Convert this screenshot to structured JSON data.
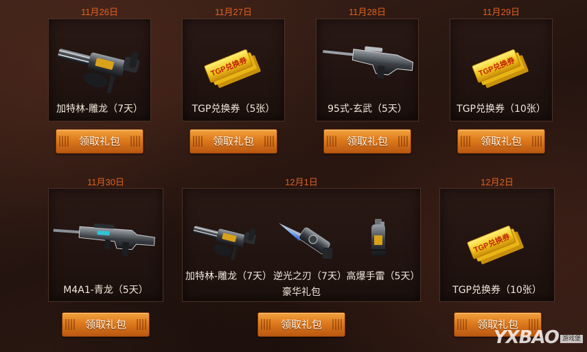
{
  "claim_label": "领取礼包",
  "days": [
    {
      "date": "11月26日",
      "items": [
        "加特林-雕龙（7天）"
      ],
      "art": [
        "gatling-gun-icon"
      ]
    },
    {
      "date": "11月27日",
      "items": [
        "TGP兑换券（5张）"
      ],
      "art": [
        "tgp-voucher-icon"
      ]
    },
    {
      "date": "11月28日",
      "items": [
        "95式-玄武（5天）"
      ],
      "art": [
        "rifle-icon"
      ]
    },
    {
      "date": "11月29日",
      "items": [
        "TGP兑换券（10张）"
      ],
      "art": [
        "tgp-voucher-icon"
      ]
    },
    {
      "date": "11月30日",
      "items": [
        "M4A1-青龙（5天）"
      ],
      "art": [
        "m4a1-rifle-icon"
      ]
    },
    {
      "date": "12月1日",
      "items": [
        "加特林-雕龙（7天）",
        "逆光之刃（7天）",
        "高爆手雷（5天）"
      ],
      "art": [
        "gatling-gun-icon",
        "blade-icon",
        "grenade-icon"
      ],
      "bundle_name": "豪华礼包"
    },
    {
      "date": "12月2日",
      "items": [
        "TGP兑换券（10张）"
      ],
      "art": [
        "tgp-voucher-icon"
      ]
    }
  ],
  "voucher_text": "TGP兑换券",
  "watermark": {
    "brand": "YXBAO",
    "tag": "游戏堡"
  },
  "colors": {
    "date": "#e0601e",
    "button": "#dd7a1c",
    "card_border": "#4c3228",
    "background": "#2a1915"
  }
}
